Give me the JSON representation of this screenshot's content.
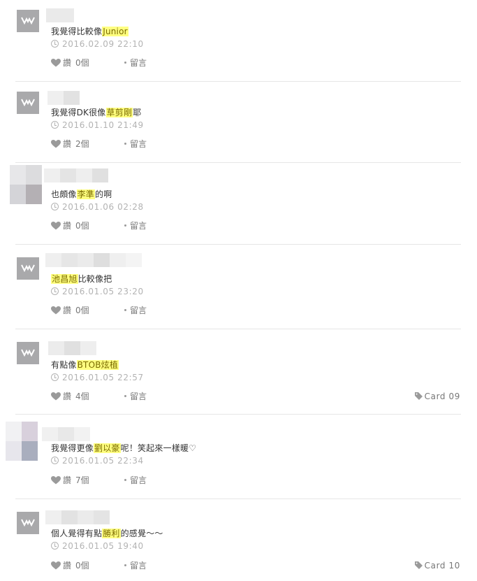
{
  "comments": [
    {
      "text_before": "我覺得比較像",
      "highlight": "Junior",
      "text_after": "",
      "timestamp": "2016.02.09 22:10",
      "like_label": "讚",
      "like_count": "0個",
      "reply_label": "留言",
      "tag": ""
    },
    {
      "text_before": "我覺得DK很像",
      "highlight": "草剪剛",
      "text_after": "耶",
      "timestamp": "2016.01.10 21:49",
      "like_label": "讚",
      "like_count": "2個",
      "reply_label": "留言",
      "tag": ""
    },
    {
      "text_before": "也頗像",
      "highlight": "李準",
      "text_after": "的啊",
      "timestamp": "2016.01.06 02:28",
      "like_label": "讚",
      "like_count": "0個",
      "reply_label": "留言",
      "tag": ""
    },
    {
      "text_before": "",
      "highlight": "池昌旭",
      "text_after": "比較像把",
      "timestamp": "2016.01.05 23:20",
      "like_label": "讚",
      "like_count": "0個",
      "reply_label": "留言",
      "tag": ""
    },
    {
      "text_before": "有點像",
      "highlight": "BTOB炫植",
      "text_after": "",
      "timestamp": "2016.01.05 22:57",
      "like_label": "讚",
      "like_count": "4個",
      "reply_label": "留言",
      "tag": "Card 09"
    },
    {
      "text_before": "我覺得更像",
      "highlight": "劉以豪",
      "text_after": "呢！笑起來一樣暖♡",
      "timestamp": "2016.01.05 22:34",
      "like_label": "讚",
      "like_count": "7個",
      "reply_label": "留言",
      "tag": ""
    },
    {
      "text_before": "個人覺得有點",
      "highlight": "勝利",
      "text_after": "的感覺～～",
      "timestamp": "2016.01.05 19:40",
      "like_label": "讚",
      "like_count": "0個",
      "reply_label": "留言",
      "tag": "Card 10"
    }
  ],
  "icons": {
    "avatar": "default-avatar-icon",
    "clock": "clock-icon",
    "like": "heart-icon",
    "reply": "bullet-dot-icon",
    "tag": "tag-icon"
  },
  "colors": {
    "highlight_bg": "#ffff80",
    "avatar_gray": "#a9a9ab",
    "meta_gray": "#b3b3b3",
    "divider": "#e6e6e6"
  }
}
